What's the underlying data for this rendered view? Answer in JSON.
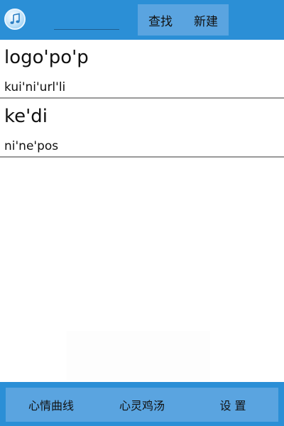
{
  "header": {
    "app_icon": "music-note-icon",
    "search_value": "",
    "actions": [
      "查找",
      "新建"
    ]
  },
  "entries": [
    {
      "title": "logo'po'p",
      "subtitle": "kui'ni'url'li"
    },
    {
      "title": "ke'di",
      "subtitle": "ni'ne'pos"
    }
  ],
  "bottom_nav": [
    "心情曲线",
    "心灵鸡汤",
    "设 置"
  ],
  "colors": {
    "bar": "#2b8fd6",
    "bar_inner": "#5aa4e0",
    "divider": "#9a9a9a"
  }
}
